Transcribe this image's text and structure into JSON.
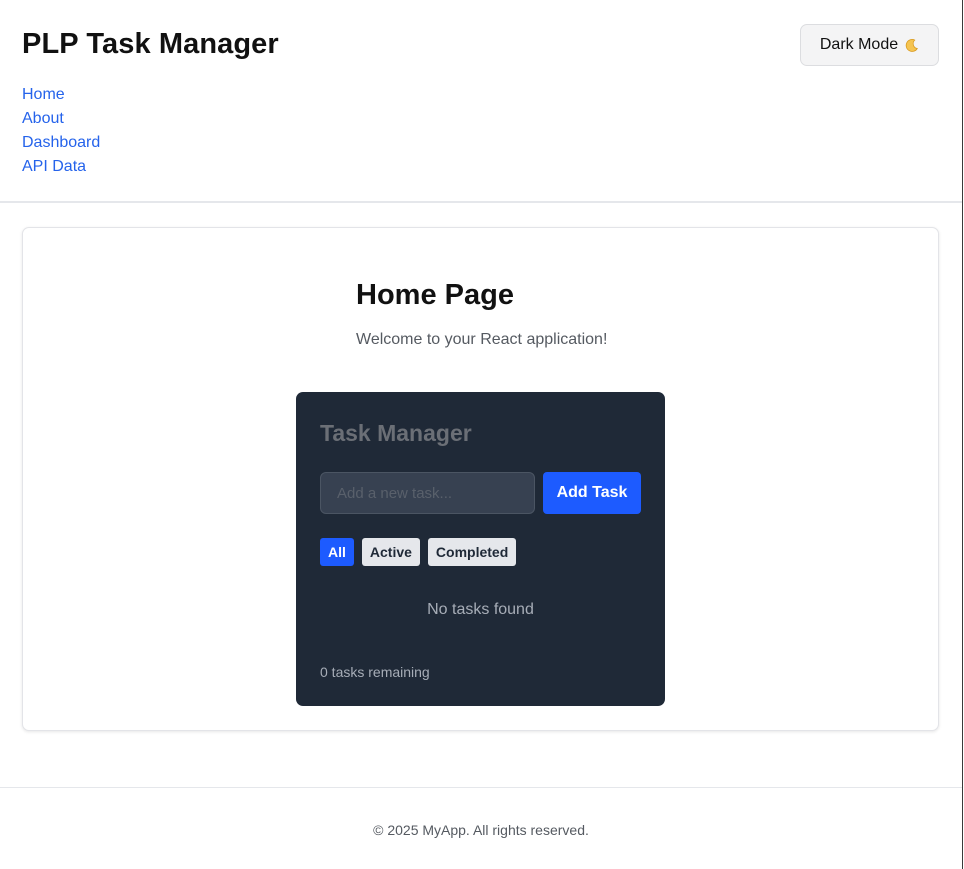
{
  "header": {
    "title": "PLP Task Manager",
    "nav": [
      {
        "label": "Home"
      },
      {
        "label": "About"
      },
      {
        "label": "Dashboard"
      },
      {
        "label": "API Data"
      }
    ],
    "theme_toggle": {
      "label": "Dark Mode",
      "icon": "moon-icon"
    }
  },
  "main": {
    "heading": "Home Page",
    "subtitle": "Welcome to your React application!",
    "task_manager": {
      "title": "Task Manager",
      "input": {
        "placeholder": "Add a new task...",
        "value": ""
      },
      "add_button_label": "Add Task",
      "filters": [
        {
          "label": "All",
          "active": true
        },
        {
          "label": "Active",
          "active": false
        },
        {
          "label": "Completed",
          "active": false
        }
      ],
      "empty_message": "No tasks found",
      "remaining_text": "0 tasks remaining"
    }
  },
  "footer": {
    "copyright": "© 2025 MyApp. All rights reserved."
  },
  "colors": {
    "accent": "#1d5bff",
    "link": "#2563eb",
    "panel_bg": "#1f2937"
  }
}
